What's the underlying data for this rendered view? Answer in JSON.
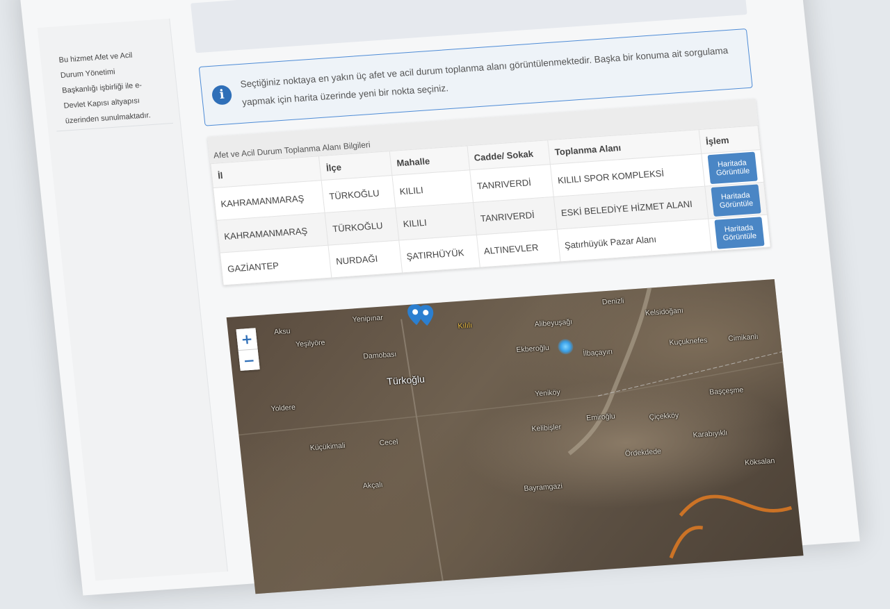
{
  "sidebar": {
    "info_lines": [
      "Bu hizmet Afet ve Acil",
      "Durum Yönetimi",
      "Başkanlığı işbirliği ile e-",
      "Devlet Kapısı altyapısı",
      "üzerinden sunulmaktadır."
    ]
  },
  "alert": {
    "icon": "info-circle-icon",
    "text": "Seçtiğiniz noktaya en yakın üç afet ve acil durum toplanma alanı görüntülenmektedir. Başka bir konuma ait sorgulama yapmak için harita üzerinde yeni bir nokta seçiniz."
  },
  "table": {
    "caption": "Afet ve Acil Durum Toplanma Alanı Bilgileri",
    "headers": [
      "İl",
      "İlçe",
      "Mahalle",
      "Cadde/ Sokak",
      "Toplanma Alanı",
      "İşlem"
    ],
    "rows": [
      {
        "il": "KAHRAMANMARAŞ",
        "ilce": "TÜRKOĞLU",
        "mahalle": "KILILI",
        "cadde": "TANRIVERDİ",
        "alan": "KILILI SPOR KOMPLEKSİ",
        "action": "Haritada Görüntüle"
      },
      {
        "il": "KAHRAMANMARAŞ",
        "ilce": "TÜRKOĞLU",
        "mahalle": "KILILI",
        "cadde": "TANRIVERDİ",
        "alan": "ESKİ BELEDİYE HİZMET ALANI",
        "action": "Haritada Görüntüle"
      },
      {
        "il": "GAZİANTEP",
        "ilce": "NURDAĞI",
        "mahalle": "ŞATIRHÜYÜK",
        "cadde": "ALTINEVLER",
        "alan": "Şatırhüyük Pazar Alanı",
        "action": "Haritada Görüntüle"
      }
    ]
  },
  "map": {
    "zoom_in": "+",
    "zoom_out": "−",
    "places": {
      "aksu": "Aksu",
      "yesilyore": "Yeşilyöre",
      "yenipinar": "Yenipınar",
      "damobasi": "Damobası",
      "turkoglu": "Türkoğlu",
      "yoldere": "Yoldere",
      "kucukimali": "Küçükimali",
      "cecel": "Cecel",
      "akcali": "Akçalı",
      "bayramgazi": "Bayramgazi",
      "denizli": "Denizli",
      "kelsidogani": "Kelsidoğanı",
      "alibeyusagi": "Alibeyuşağı",
      "ekberoglu": "Ekberoğlu",
      "ilbacayiri": "İlbaçayırı",
      "kucuknefes": "Kuçuknefes",
      "cimikanli": "Cimikanlı",
      "yenikoy": "Yeniköy",
      "kelibisler": "Kelibişler",
      "emiroglu": "Emiroğlu",
      "cicekkoy": "Çiçekköy",
      "bascesme": "Başçeşme",
      "ordekdede": "Ördekdede",
      "karabiyikli": "Karabıyıklı",
      "koksalan": "Köksalan",
      "kilili": "Kılılı"
    }
  }
}
